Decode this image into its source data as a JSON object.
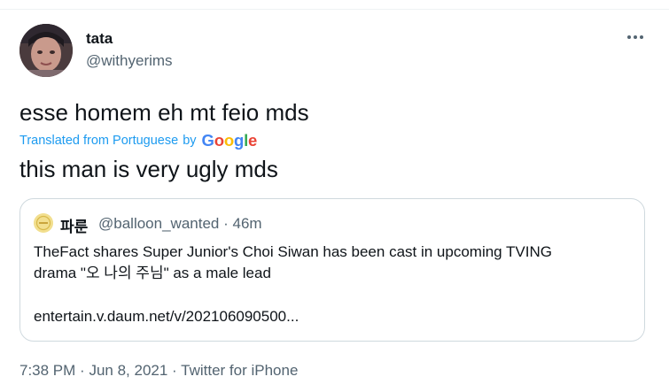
{
  "author": {
    "name": "tata",
    "handle": "@withyerims"
  },
  "tweet": {
    "original_text": "esse homem eh mt feio mds",
    "translated_label": "Translated from Portuguese",
    "translated_by": "by",
    "translator": "Google",
    "translated_text": "this man is very ugly mds"
  },
  "quote": {
    "name": "파룬",
    "handle": "@balloon_wanted",
    "separator": "·",
    "time": "46m",
    "line1": "TheFact shares Super Junior's Choi Siwan has been cast in upcoming TVING",
    "line2": "drama \"오 나의 주님\" as a male lead",
    "link": "entertain.v.daum.net/v/202106090500..."
  },
  "meta": {
    "time": "7:38 PM",
    "sep1": "·",
    "date": "Jun 8, 2021",
    "sep2": "·",
    "source": "Twitter for iPhone"
  },
  "colors": {
    "text": "#0f1419",
    "secondary": "#536471",
    "link_blue": "#1d9bf0",
    "border": "#cfd9de",
    "google_blue": "#4285F4",
    "google_red": "#EA4335",
    "google_yellow": "#FBBC05",
    "google_green": "#34A853"
  },
  "icons": {
    "more": "more-horizontal-icon"
  }
}
